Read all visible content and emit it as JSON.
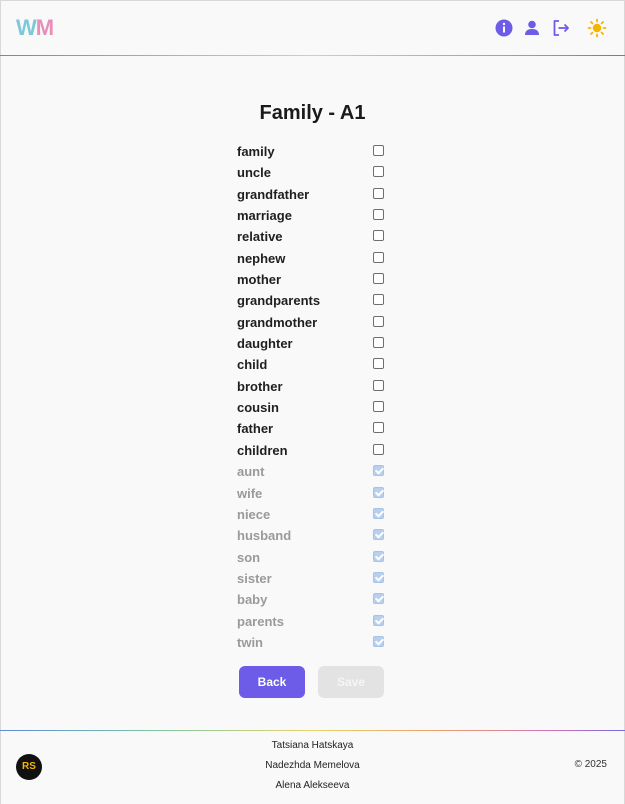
{
  "header": {
    "logo_w": "W",
    "logo_m": "M",
    "icons": [
      "info-icon",
      "user-icon",
      "logout-icon",
      "sun-icon"
    ]
  },
  "main": {
    "title": "Family - A1",
    "words": [
      {
        "word": "family",
        "checked": false
      },
      {
        "word": "uncle",
        "checked": false
      },
      {
        "word": "grandfather",
        "checked": false
      },
      {
        "word": "marriage",
        "checked": false
      },
      {
        "word": "relative",
        "checked": false
      },
      {
        "word": "nephew",
        "checked": false
      },
      {
        "word": "mother",
        "checked": false
      },
      {
        "word": "grandparents",
        "checked": false
      },
      {
        "word": "grandmother",
        "checked": false
      },
      {
        "word": "daughter",
        "checked": false
      },
      {
        "word": "child",
        "checked": false
      },
      {
        "word": "brother",
        "checked": false
      },
      {
        "word": "cousin",
        "checked": false
      },
      {
        "word": "father",
        "checked": false
      },
      {
        "word": "children",
        "checked": false
      },
      {
        "word": "aunt",
        "checked": true
      },
      {
        "word": "wife",
        "checked": true
      },
      {
        "word": "niece",
        "checked": true
      },
      {
        "word": "husband",
        "checked": true
      },
      {
        "word": "son",
        "checked": true
      },
      {
        "word": "sister",
        "checked": true
      },
      {
        "word": "baby",
        "checked": true
      },
      {
        "word": "parents",
        "checked": true
      },
      {
        "word": "twin",
        "checked": true
      }
    ],
    "back_label": "Back",
    "save_label": "Save"
  },
  "footer": {
    "badge": "RS",
    "authors": [
      "Tatsiana Hatskaya",
      "Nadezhda Memelova",
      "Alena Alekseeva"
    ],
    "copyright": "© 2025"
  },
  "colors": {
    "accent": "#6c5ce7",
    "sun": "#f5b400",
    "checked": "#b7d0f0"
  }
}
